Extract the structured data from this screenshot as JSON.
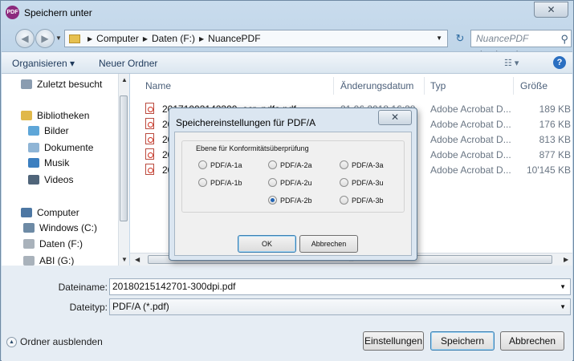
{
  "window": {
    "title": "Speichern unter",
    "app_icon": "PDF",
    "close_icon": "close-icon",
    "close_glyph": "✕"
  },
  "nav": {
    "breadcrumb": [
      "Computer",
      "Daten (F:)",
      "NuancePDF"
    ],
    "search_placeholder": "NuancePDF durchsuchen",
    "back_glyph": "◀",
    "forward_glyph": "▶",
    "dropdown_glyph": "▼",
    "refresh_glyph": "↻",
    "search_glyph": "⚲",
    "separator_glyph": "▶"
  },
  "toolbar": {
    "organize_label": "Organisieren ▾",
    "new_folder_label": "Neuer Ordner",
    "view_glyph": "☷ ▾",
    "help_glyph": "?"
  },
  "sidebar": {
    "items": [
      {
        "label": "Zuletzt besucht",
        "icon": "recent-places-icon",
        "color": "#8a9cb0"
      },
      {
        "label": "Bibliotheken",
        "icon": "libraries-icon",
        "color": "#e0b84a"
      },
      {
        "label": "Bilder",
        "icon": "pictures-icon",
        "color": "#5ea6d8"
      },
      {
        "label": "Dokumente",
        "icon": "documents-icon",
        "color": "#8fb5d6"
      },
      {
        "label": "Musik",
        "icon": "music-icon",
        "color": "#3c7fc0"
      },
      {
        "label": "Videos",
        "icon": "videos-icon",
        "color": "#50657a"
      },
      {
        "label": "Computer",
        "icon": "computer-icon",
        "color": "#4d77a3"
      },
      {
        "label": "Windows (C:)",
        "icon": "drive-icon",
        "color": "#6d8aa5"
      },
      {
        "label": "Daten (F:)",
        "icon": "drive-icon",
        "color": "#a9b2bb"
      },
      {
        "label": "ABI (G:)",
        "icon": "drive-icon",
        "color": "#a9b2bb"
      }
    ]
  },
  "files": {
    "columns": [
      "Name",
      "Änderungsdatum",
      "Typ",
      "Größe"
    ],
    "rows": [
      {
        "name": "20171003142300_ocr_pdfa.pdf",
        "date": "21.06.2018 16:38",
        "type": "Adobe Acrobat D...",
        "size": "189 KB"
      },
      {
        "name": "20",
        "date": "",
        "type": "Adobe Acrobat D...",
        "size": "176 KB"
      },
      {
        "name": "20",
        "date": "",
        "type": "Adobe Acrobat D...",
        "size": "813 KB"
      },
      {
        "name": "20",
        "date": "",
        "type": "Adobe Acrobat D...",
        "size": "877 KB"
      },
      {
        "name": "20",
        "date": "",
        "type": "Adobe Acrobat D...",
        "size": "10'145 KB"
      }
    ]
  },
  "form": {
    "filename_label": "Dateiname:",
    "filename_value": "20180215142701-300dpi.pdf",
    "filetype_label": "Dateityp:",
    "filetype_value": "PDF/A (*.pdf)",
    "hide_folders_label": "Ordner ausblenden",
    "hide_folders_glyph": "▲",
    "settings_button": "Einstellungen",
    "save_button": "Speichern",
    "cancel_button": "Abbrechen"
  },
  "dialog": {
    "title": "Speichereinstellungen für PDF/A",
    "close_glyph": "✕",
    "group_label": "Ebene für Konformitätsüberprüfung",
    "options": [
      "PDF/A-1a",
      "PDF/A-2a",
      "PDF/A-3a",
      "PDF/A-1b",
      "PDF/A-2u",
      "PDF/A-3u",
      "PDF/A-2b",
      "PDF/A-3b"
    ],
    "selected": "PDF/A-2b",
    "ok_button": "OK",
    "cancel_button": "Abbrechen"
  },
  "colors": {
    "accent": "#2264b4",
    "pdf_red": "#d0301f",
    "app_icon_bg": "#8c2a7d"
  }
}
